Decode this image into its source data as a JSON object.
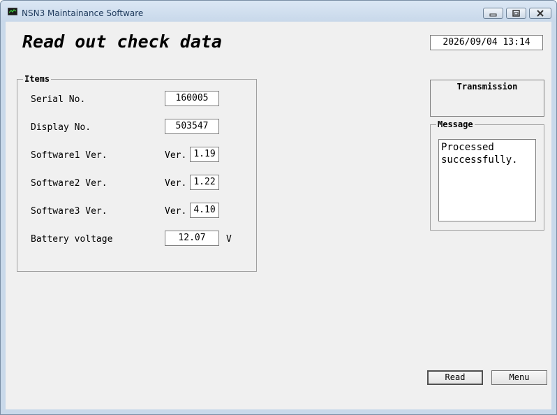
{
  "window": {
    "title": "NSN3 Maintainance Software"
  },
  "page": {
    "heading": "Read out check data",
    "datetime": "2026/09/04 13:14"
  },
  "items": {
    "legend": "Items",
    "serial_label": "Serial No.",
    "serial_value": "160005",
    "display_label": "Display No.",
    "display_value": "503547",
    "sw1_label": "Software1 Ver.",
    "sw1_prefix": "Ver.",
    "sw1_value": "1.19",
    "sw2_label": "Software2 Ver.",
    "sw2_prefix": "Ver.",
    "sw2_value": "1.22",
    "sw3_label": "Software3 Ver.",
    "sw3_prefix": "Ver.",
    "sw3_value": "4.10",
    "battery_label": "Battery voltage",
    "battery_value": "12.07",
    "battery_unit": "V"
  },
  "transmission": {
    "label": "Transmission"
  },
  "message": {
    "legend": "Message",
    "text": "Processed\nsuccessfully."
  },
  "buttons": {
    "read": "Read",
    "menu": "Menu"
  },
  "icons": {
    "app": "app-monitor-icon",
    "minimize": "minimize-icon",
    "restore": "restore-icon",
    "close": "close-icon"
  }
}
